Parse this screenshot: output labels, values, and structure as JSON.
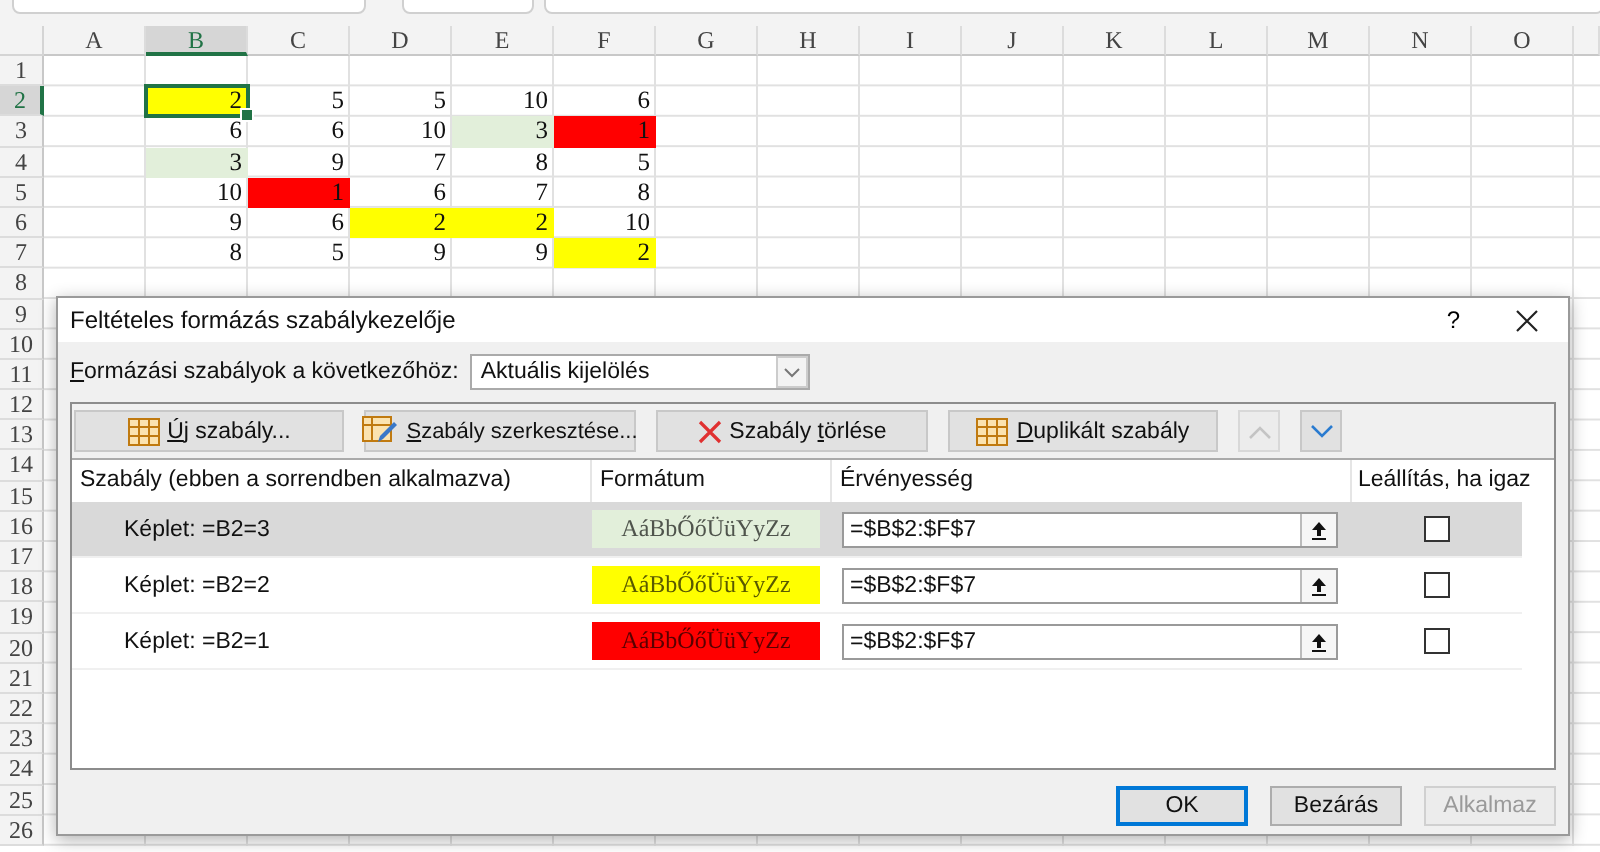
{
  "sheet": {
    "columns": [
      {
        "label": "A",
        "selected": false
      },
      {
        "label": "B",
        "selected": true
      },
      {
        "label": "C",
        "selected": false
      },
      {
        "label": "D",
        "selected": false
      },
      {
        "label": "E",
        "selected": false
      },
      {
        "label": "F",
        "selected": false
      },
      {
        "label": "G",
        "selected": false
      },
      {
        "label": "H",
        "selected": false
      },
      {
        "label": "I",
        "selected": false
      },
      {
        "label": "J",
        "selected": false
      },
      {
        "label": "K",
        "selected": false
      },
      {
        "label": "L",
        "selected": false
      },
      {
        "label": "M",
        "selected": false
      },
      {
        "label": "N",
        "selected": false
      },
      {
        "label": "O",
        "selected": false
      }
    ],
    "rows": [
      {
        "label": "1",
        "selected": false
      },
      {
        "label": "2",
        "selected": true,
        "cells": [
          {
            "value": "2",
            "color": "#ffff00",
            "selected": true
          },
          {
            "value": "5",
            "selected": false
          },
          {
            "value": "5",
            "selected": false
          },
          {
            "value": "10",
            "selected": false
          },
          {
            "value": "6",
            "selected": false
          }
        ]
      },
      {
        "label": "3",
        "selected": false,
        "cells": [
          {
            "value": "6",
            "selected": false
          },
          {
            "value": "6",
            "selected": false
          },
          {
            "value": "10",
            "selected": false
          },
          {
            "value": "3",
            "color": "#e2efda",
            "selected": false
          },
          {
            "value": "1",
            "color": "#ff0000",
            "selected": false
          }
        ]
      },
      {
        "label": "4",
        "selected": false,
        "cells": [
          {
            "value": "3",
            "color": "#e2efda",
            "selected": false
          },
          {
            "value": "9",
            "selected": false
          },
          {
            "value": "7",
            "selected": false
          },
          {
            "value": "8",
            "selected": false
          },
          {
            "value": "5",
            "selected": false
          }
        ]
      },
      {
        "label": "5",
        "selected": false,
        "cells": [
          {
            "value": "10",
            "selected": false
          },
          {
            "value": "1",
            "color": "#ff0000",
            "selected": false
          },
          {
            "value": "6",
            "selected": false
          },
          {
            "value": "7",
            "selected": false
          },
          {
            "value": "8",
            "selected": false
          }
        ]
      },
      {
        "label": "6",
        "selected": false,
        "cells": [
          {
            "value": "9",
            "selected": false
          },
          {
            "value": "6",
            "selected": false
          },
          {
            "value": "2",
            "color": "#ffff00",
            "selected": false
          },
          {
            "value": "2",
            "color": "#ffff00",
            "selected": false
          },
          {
            "value": "10",
            "selected": false
          }
        ]
      },
      {
        "label": "7",
        "selected": false,
        "cells": [
          {
            "value": "8",
            "selected": false
          },
          {
            "value": "5",
            "selected": false
          },
          {
            "value": "9",
            "selected": false
          },
          {
            "value": "9",
            "selected": false
          },
          {
            "value": "2",
            "color": "#ffff00",
            "selected": false
          }
        ]
      },
      {
        "label": "8",
        "selected": false
      },
      {
        "label": "9",
        "selected": false
      },
      {
        "label": "10",
        "selected": false
      },
      {
        "label": "11",
        "selected": false
      },
      {
        "label": "12",
        "selected": false
      },
      {
        "label": "13",
        "selected": false
      },
      {
        "label": "14",
        "selected": false
      },
      {
        "label": "15",
        "selected": false
      },
      {
        "label": "16",
        "selected": false
      },
      {
        "label": "17",
        "selected": false
      },
      {
        "label": "18",
        "selected": false
      },
      {
        "label": "19",
        "selected": false
      },
      {
        "label": "20",
        "selected": false
      },
      {
        "label": "21",
        "selected": false
      },
      {
        "label": "22",
        "selected": false
      },
      {
        "label": "23",
        "selected": false
      },
      {
        "label": "24",
        "selected": false
      },
      {
        "label": "25",
        "selected": false
      },
      {
        "label": "26",
        "selected": false
      }
    ]
  },
  "dialog": {
    "title": "Feltételes formázás szabálykezelője",
    "help": "?",
    "scope": {
      "label": {
        "key": "F",
        "after": "ormázási szabályok a következőhöz:"
      },
      "value": "Aktuális kijelölés"
    },
    "toolbar": [
      {
        "kind": "new",
        "label": {
          "key": "Ú",
          "after": "j szabály..."
        },
        "disabled": false
      },
      {
        "kind": "edit",
        "label": {
          "key": "S",
          "after": "zabály szerkesztése..."
        },
        "disabled": false
      },
      {
        "kind": "delete",
        "label": {
          "before": "Szabály ",
          "key": "t",
          "after": "örlése"
        },
        "disabled": false
      },
      {
        "kind": "duplicate",
        "label": {
          "key": "D",
          "after": "uplikált szabály"
        },
        "disabled": false
      },
      {
        "kind": "up",
        "disabled": true
      },
      {
        "kind": "down",
        "disabled": false
      }
    ],
    "columns": [
      "Szabály (ebben a sorrendben alkalmazva)",
      "Formátum",
      "Érvényesség",
      "Leállítás, ha igaz"
    ],
    "rules": [
      {
        "rule": "Képlet: =B2=3",
        "preview": "AáBbŐőÜüYyZz",
        "color": "#e2efda",
        "range": "=$B$2:$F$7",
        "stop": false,
        "selected": true
      },
      {
        "rule": "Képlet: =B2=2",
        "preview": "AáBbŐőÜüYyZz",
        "color": "#ffff00",
        "range": "=$B$2:$F$7",
        "stop": false,
        "selected": false
      },
      {
        "rule": "Képlet: =B2=1",
        "preview": "AáBbŐőÜüYyZz",
        "color": "#ff0000",
        "range": "=$B$2:$F$7",
        "stop": false,
        "selected": false
      }
    ],
    "buttons": [
      {
        "label": "OK",
        "default": true,
        "disabled": false
      },
      {
        "label": "Bezárás",
        "default": false,
        "disabled": false
      },
      {
        "label": "Alkalmaz",
        "default": false,
        "disabled": true
      }
    ]
  }
}
